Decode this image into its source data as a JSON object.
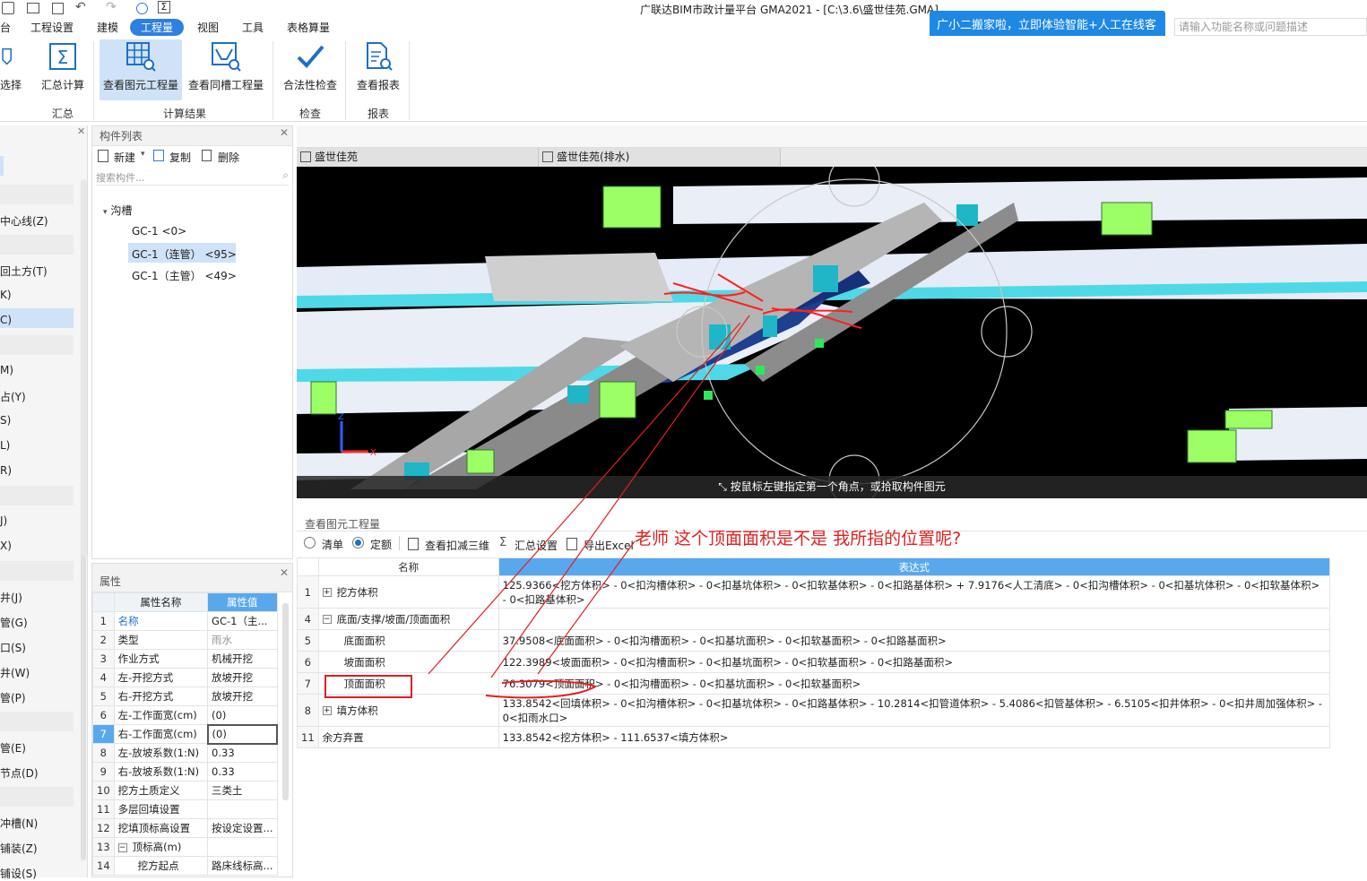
{
  "window": {
    "title": "广联达BIM市政计量平台 GMA2021 - [C:\\3.6\\盛世佳苑.GMA]"
  },
  "help": {
    "chat": "广小二搬家啦，立即体验智能+人工在线客服",
    "search_placeholder": "请输入功能名称或问题描述"
  },
  "menu": [
    {
      "label": "台"
    },
    {
      "label": "工程设置"
    },
    {
      "label": "建模"
    },
    {
      "label": "工程量",
      "active": true
    },
    {
      "label": "视图"
    },
    {
      "label": "工具"
    },
    {
      "label": "表格算量"
    }
  ],
  "ribbon": {
    "buttons": {
      "select": "选择",
      "summary_calc": "汇总计算",
      "view_element_qty": "查看图元工程量",
      "view_same_trench_qty": "查看同槽工程量",
      "legality_check": "合法性检查",
      "view_report": "查看报表"
    },
    "groups": {
      "summary": "汇总",
      "calc_result": "计算结果",
      "check": "检查",
      "report": "报表"
    }
  },
  "left_strip": [
    "中心线(Z)",
    "回土方(T)",
    "K)",
    "C)",
    "M)",
    "占(Y)",
    "S)",
    "L)",
    "R)",
    "J)",
    "X)",
    "井(J)",
    "管(G)",
    "口(S)",
    "井(W)",
    "管(P)",
    "管(E)",
    "节点(D)",
    "冲槽(N)",
    "铺装(Z)",
    "铺设(S)"
  ],
  "component_list": {
    "title": "构件列表",
    "toolbar": {
      "new": "新建",
      "copy": "复制",
      "delete": "删除"
    },
    "search_placeholder": "搜索构件...",
    "group": "沟槽",
    "items": [
      {
        "label": "GC-1 <0>"
      },
      {
        "label": "GC-1（连管） <95>",
        "selected": true
      },
      {
        "label": "GC-1（主管） <49>"
      }
    ]
  },
  "properties": {
    "title": "属性",
    "headers": {
      "name": "属性名称",
      "value": "属性值"
    },
    "rows": [
      {
        "n": "1",
        "name": "名称",
        "value": "GC-1（主..."
      },
      {
        "n": "2",
        "name": "类型",
        "value": "雨水"
      },
      {
        "n": "3",
        "name": "作业方式",
        "value": "机械开挖"
      },
      {
        "n": "4",
        "name": "左-开挖方式",
        "value": "放坡开挖"
      },
      {
        "n": "5",
        "name": "右-开挖方式",
        "value": "放坡开挖"
      },
      {
        "n": "6",
        "name": "左-工作面宽(cm)",
        "value": "(0)"
      },
      {
        "n": "7",
        "name": "右-工作面宽(cm)",
        "value": "(0)"
      },
      {
        "n": "8",
        "name": "左-放坡系数(1:N)",
        "value": "0.33"
      },
      {
        "n": "9",
        "name": "右-放坡系数(1:N)",
        "value": "0.33"
      },
      {
        "n": "10",
        "name": "挖方土质定义",
        "value": "三类土"
      },
      {
        "n": "11",
        "name": "多层回填设置",
        "value": ""
      },
      {
        "n": "12",
        "name": "挖填顶标高设置",
        "value": "按设定设置..."
      },
      {
        "n": "13",
        "name": "顶标高(m)",
        "value": ""
      },
      {
        "n": "14",
        "name": "挖方起点",
        "value": "路床线标高..."
      }
    ]
  },
  "view_tabs": [
    {
      "label": "盛世佳苑"
    },
    {
      "label": "盛世佳苑(排水)"
    }
  ],
  "viewport": {
    "status": "按鼠标左键指定第一个角点，或拾取构件图元"
  },
  "qty_panel": {
    "title": "查看图元工程量",
    "radios": {
      "list": "清单",
      "quota": "定额"
    },
    "tools": {
      "view_deduct_3d": "查看扣减三维",
      "summary_settings": "汇总设置",
      "export_excel": "导出Excel"
    },
    "headers": {
      "name": "名称",
      "expr": "表达式"
    },
    "rows": [
      {
        "n": "1",
        "name": "挖方体积",
        "sign": "+",
        "indent": 0,
        "expr": "125.9366<挖方体积> - 0<扣沟槽体积> - 0<扣基坑体积> - 0<扣软基体积> - 0<扣路基体积> + 7.9176<人工清底> - 0<扣沟槽体积> - 0<扣基坑体积> - 0<扣软基体积> - 0<扣路基体积>"
      },
      {
        "n": "4",
        "name": "底面/支撑/坡面/顶面面积",
        "sign": "−",
        "indent": 0,
        "expr": ""
      },
      {
        "n": "5",
        "name": "底面面积",
        "sign": "",
        "indent": 1,
        "expr": "37.9508<底面面积> - 0<扣沟槽面积> - 0<扣基坑面积> - 0<扣软基面积> - 0<扣路基面积>"
      },
      {
        "n": "6",
        "name": "坡面面积",
        "sign": "",
        "indent": 1,
        "expr": "122.3989<坡面面积> - 0<扣沟槽面积> - 0<扣基坑面积> - 0<扣软基面积> - 0<扣路基面积>"
      },
      {
        "n": "7",
        "name": "顶面面积",
        "sign": "",
        "indent": 1,
        "expr": "76.3079<顶面面积> - 0<扣沟槽面积> - 0<扣基坑面积> - 0<扣软基面积>"
      },
      {
        "n": "8",
        "name": "填方体积",
        "sign": "+",
        "indent": 0,
        "expr": "133.8542<回填体积> - 0<扣沟槽体积> - 0<扣基坑体积> - 0<扣路基体积> - 10.2814<扣管道体积> - 5.4086<扣管基体积> - 6.5105<扣井体积> - 0<扣井周加强体积> - 0<扣雨水口>"
      },
      {
        "n": "11",
        "name": "余方弃置",
        "sign": "",
        "indent": 0,
        "expr": "133.8542<挖方体积> - 111.6537<填方体积>"
      }
    ]
  },
  "annotation": {
    "question": "老师 这个顶面面积是不是 我所指的位置呢?"
  }
}
